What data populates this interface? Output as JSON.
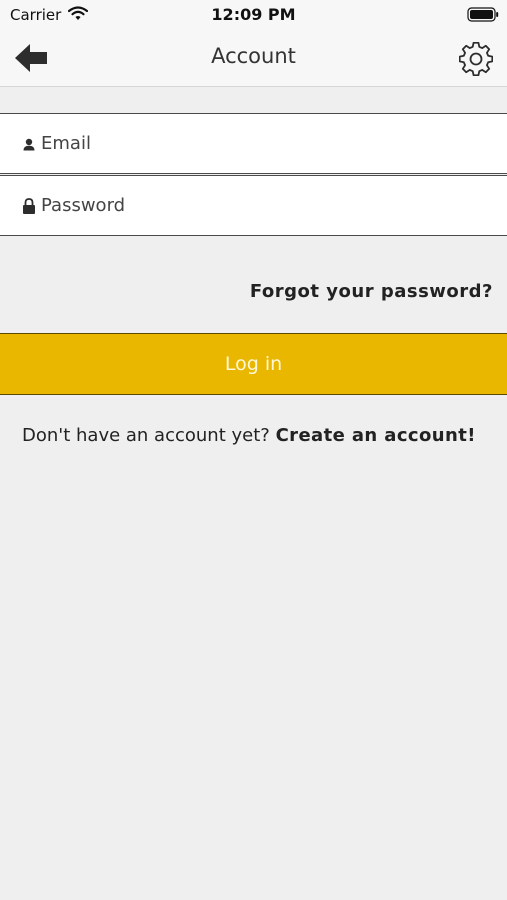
{
  "status_bar": {
    "carrier": "Carrier",
    "time": "12:09 PM",
    "wifi_icon": "wifi-icon",
    "battery_icon": "battery-icon"
  },
  "nav": {
    "title": "Account",
    "back_icon": "back-arrow-icon",
    "settings_icon": "gear-icon"
  },
  "form": {
    "email_placeholder": "Email",
    "email_value": "",
    "password_placeholder": "Password",
    "password_value": "",
    "email_icon": "person-icon",
    "password_icon": "lock-icon"
  },
  "actions": {
    "forgot_password": "Forgot your password?",
    "login_label": "Log in",
    "signup_prompt": "Don't have an account yet?",
    "signup_link": "Create an account!"
  },
  "colors": {
    "accent": "#e9b700",
    "background": "#efefef",
    "field_background": "#ffffff"
  }
}
